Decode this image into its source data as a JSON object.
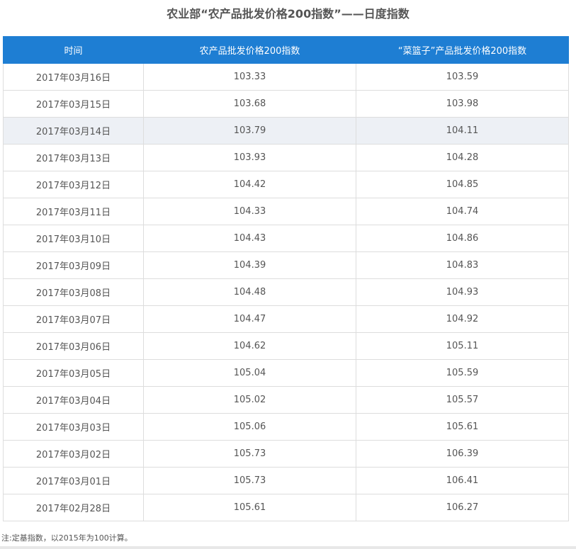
{
  "title": "农业部“农产品批发价格200指数”——日度指数",
  "table": {
    "headers": [
      "时间",
      "农产品批发价格200指数",
      "“菜篮子”产品批发价格200指数"
    ],
    "rows": [
      {
        "date": "2017年03月16日",
        "agri_index": "103.33",
        "basket_index": "103.59"
      },
      {
        "date": "2017年03月15日",
        "agri_index": "103.68",
        "basket_index": "103.98"
      },
      {
        "date": "2017年03月14日",
        "agri_index": "103.79",
        "basket_index": "104.11"
      },
      {
        "date": "2017年03月13日",
        "agri_index": "103.93",
        "basket_index": "104.28"
      },
      {
        "date": "2017年03月12日",
        "agri_index": "104.42",
        "basket_index": "104.85"
      },
      {
        "date": "2017年03月11日",
        "agri_index": "104.33",
        "basket_index": "104.74"
      },
      {
        "date": "2017年03月10日",
        "agri_index": "104.43",
        "basket_index": "104.86"
      },
      {
        "date": "2017年03月09日",
        "agri_index": "104.39",
        "basket_index": "104.83"
      },
      {
        "date": "2017年03月08日",
        "agri_index": "104.48",
        "basket_index": "104.93"
      },
      {
        "date": "2017年03月07日",
        "agri_index": "104.47",
        "basket_index": "104.92"
      },
      {
        "date": "2017年03月06日",
        "agri_index": "104.62",
        "basket_index": "105.11"
      },
      {
        "date": "2017年03月05日",
        "agri_index": "105.04",
        "basket_index": "105.59"
      },
      {
        "date": "2017年03月04日",
        "agri_index": "105.02",
        "basket_index": "105.57"
      },
      {
        "date": "2017年03月03日",
        "agri_index": "105.06",
        "basket_index": "105.61"
      },
      {
        "date": "2017年03月02日",
        "agri_index": "105.73",
        "basket_index": "106.39"
      },
      {
        "date": "2017年03月01日",
        "agri_index": "105.73",
        "basket_index": "106.41"
      },
      {
        "date": "2017年02月28日",
        "agri_index": "105.61",
        "basket_index": "106.27"
      }
    ],
    "highlighted_row_index": 2
  },
  "footnote": "注:定基指数，以2015年为100计算。",
  "colors": {
    "header_background": "#1e7ed3",
    "header_text": "#ffffff",
    "highlight_row": "#edf0f5",
    "grid_line": "#dddddd",
    "body_text": "#555555"
  }
}
